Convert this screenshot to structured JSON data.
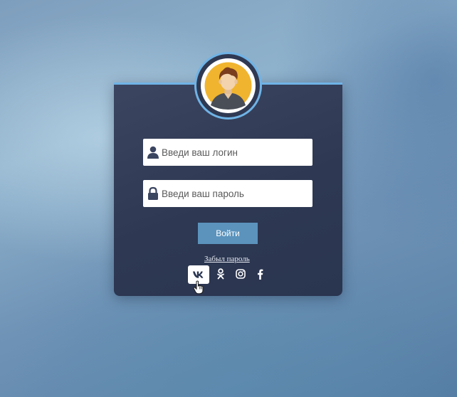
{
  "login_form": {
    "login_placeholder": "Введи ваш логин",
    "password_placeholder": "Введи ваш пароль",
    "submit_label": "Войти",
    "forgot_password_label": "Забыл пароль"
  },
  "social": [
    {
      "icon": "vk-icon"
    },
    {
      "icon": "odnoklassniki-icon"
    },
    {
      "icon": "instagram-icon"
    },
    {
      "icon": "facebook-icon"
    }
  ],
  "colors": {
    "accent": "#6fb3e6",
    "card": "#2e3852",
    "button": "#5b93bd",
    "avatar_bg": "#f0b42e"
  }
}
